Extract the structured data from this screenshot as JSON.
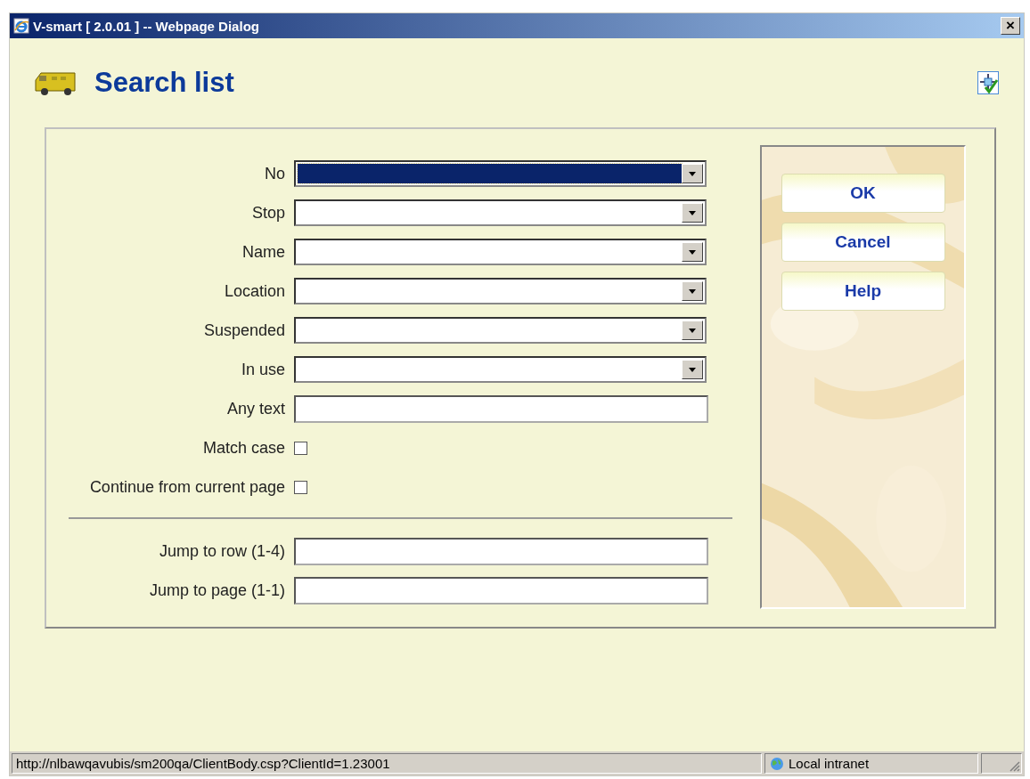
{
  "window": {
    "title": "V-smart [ 2.0.01 ] -- Webpage Dialog",
    "close": "×"
  },
  "page": {
    "title": "Search list"
  },
  "fields": [
    {
      "kind": "select",
      "label": "No",
      "focused": true
    },
    {
      "kind": "select",
      "label": "Stop",
      "focused": false
    },
    {
      "kind": "select",
      "label": "Name",
      "focused": false
    },
    {
      "kind": "select",
      "label": "Location",
      "focused": false
    },
    {
      "kind": "select",
      "label": "Suspended",
      "focused": false
    },
    {
      "kind": "select",
      "label": "In use",
      "focused": false
    },
    {
      "kind": "text",
      "label": "Any text"
    },
    {
      "kind": "checkbox",
      "label": "Match case",
      "checked": false
    },
    {
      "kind": "checkbox",
      "label": "Continue from current page",
      "checked": false
    }
  ],
  "jump_fields": [
    {
      "kind": "text",
      "label": "Jump to row (1-4)"
    },
    {
      "kind": "text",
      "label": "Jump to page (1-1)"
    }
  ],
  "buttons": [
    "OK",
    "Cancel",
    "Help"
  ],
  "status_bar": {
    "url": "http://nlbawqavubis/sm200qa/ClientBody.csp?ClientId=1.23001",
    "zone": "Local intranet"
  }
}
